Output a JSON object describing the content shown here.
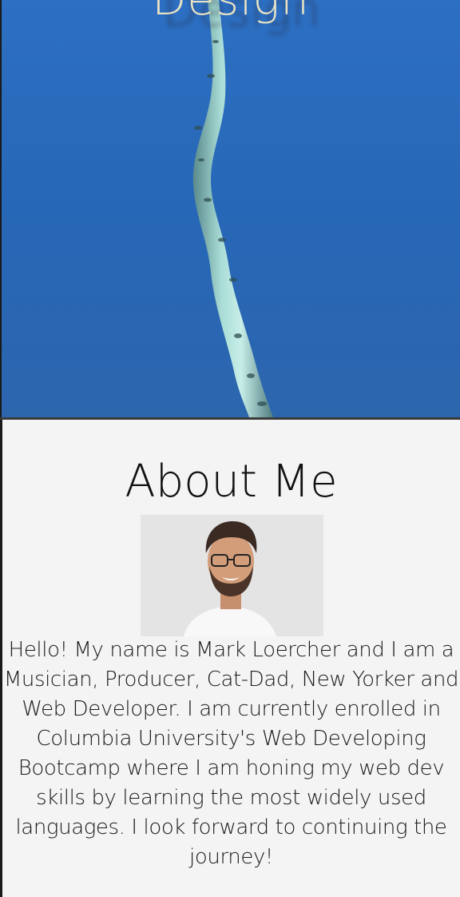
{
  "hero": {
    "title": "Design",
    "image": "branch-against-blue-sky"
  },
  "about": {
    "heading": "About Me",
    "portrait": "smiling-man-with-glasses-portrait",
    "bio": "Hello! My name is Mark Loercher and I am a Musician, Producer, Cat-Dad, New Yorker and Web Developer. I am currently enrolled in Columbia University's Web Developing Bootcamp where I am honing my web dev skills by learning the most widely used languages. I look forward to continuing the journey!"
  },
  "colors": {
    "sky_blue": "#2566b6",
    "hero_title": "#e8e2c4",
    "section_bg": "#f4f4f4",
    "text": "#1a1a1a"
  }
}
